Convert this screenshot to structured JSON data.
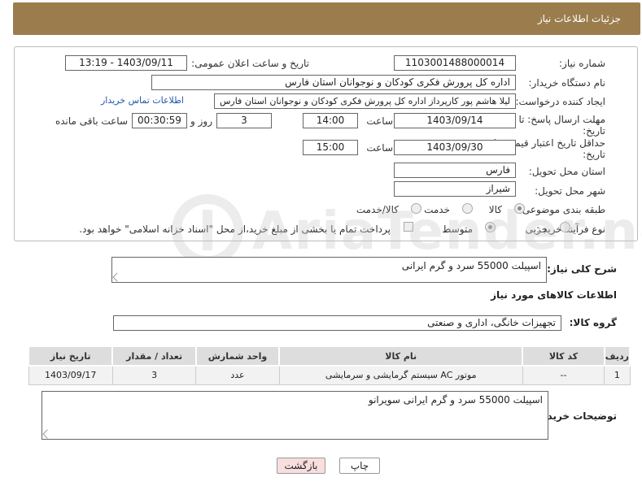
{
  "header": {
    "title": "جزئیات اطلاعات نیاز"
  },
  "form": {
    "need_number_label": "شماره نیاز:",
    "need_number": "1103001488000014",
    "announce_label": "تاریخ و ساعت اعلان عمومی:",
    "announce_value": "1403/09/11 - 13:19",
    "buyer_org_label": "نام دستگاه خریدار:",
    "buyer_org": "اداره کل پرورش فکری کودکان و نوجوانان استان فارس",
    "creator_label": "ایجاد کننده درخواست:",
    "creator": "لیلا هاشم پور کارپرداز اداره کل پرورش فکری کودکان و نوجوانان استان فارس",
    "contact_link": "اطلاعات تماس خریدار",
    "deadline_label_1": "مهلت ارسال پاسخ: تا",
    "deadline_label_2": "تاریخ:",
    "deadline_date": "1403/09/14",
    "time_label": "ساعت",
    "deadline_time": "14:00",
    "days_value": "3",
    "days_label": "روز و",
    "remaining_value": "00:30:59",
    "remaining_label": "ساعت باقی مانده",
    "validity_label_1": "حداقل تاریخ اعتبار قیمت: تا",
    "validity_label_2": "تاریخ:",
    "validity_date": "1403/09/30",
    "validity_time_label": "ساعت",
    "validity_time": "15:00",
    "province_label": "استان محل تحویل:",
    "province": "فارس",
    "city_label": "شهر محل تحویل:",
    "city": "شیراز",
    "category_label": "طبقه بندی موضوعی:",
    "category_options": [
      "کالا",
      "خدمت",
      "کالا/خدمت"
    ],
    "process_label": "نوع فرآیند خرید :",
    "process_options": [
      "جزیی",
      "متوسط"
    ],
    "payment_note": "پرداخت تمام یا بخشی از مبلغ خرید،از محل \"اسناد خزانه اسلامی\" خواهد بود."
  },
  "summary": {
    "label": "شرح کلی نیاز:",
    "value": "اسپیلت 55000 سرد و گرم ایرانی"
  },
  "goods_info": {
    "title": "اطلاعات کالاهای مورد نیاز",
    "group_label": "گروه کالا:",
    "group_value": "تجهیزات خانگی، اداری و صنعتی",
    "columns": [
      "ردیف",
      "کد کالا",
      "نام کالا",
      "واحد شمارش",
      "تعداد / مقدار",
      "تاریخ نیاز"
    ],
    "rows": [
      [
        "1",
        "--",
        "موتور AC سیستم گرمایشی و سرمایشی",
        "عدد",
        "3",
        "1403/09/17"
      ]
    ]
  },
  "buyer_notes": {
    "label": "توضیحات خریدار:",
    "value": "اسپیلت 55000 سرد و گرم ایرانی سویرانو"
  },
  "buttons": {
    "print": "چاپ",
    "back": "بازگشت"
  },
  "watermark": "AriaTender.neT",
  "colors": {
    "header": "#9b7d4d",
    "link": "#2255aa",
    "back_button": "#f8dede"
  }
}
